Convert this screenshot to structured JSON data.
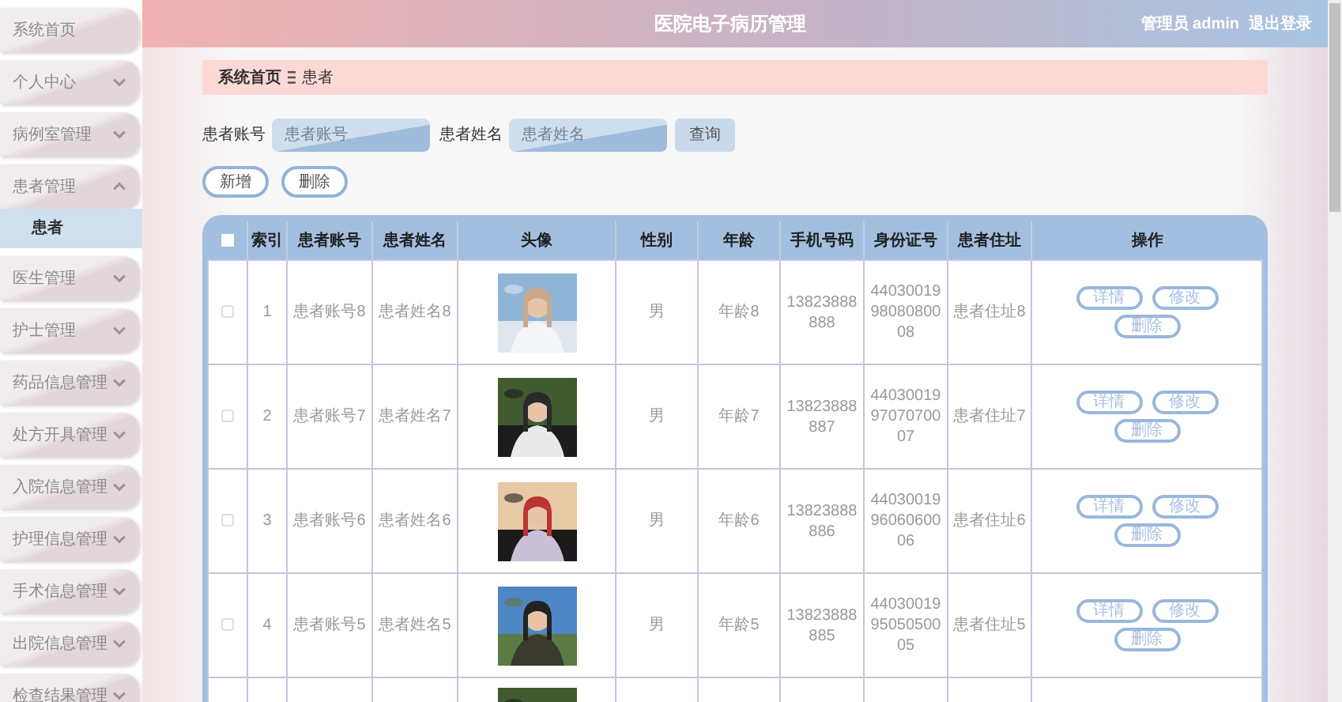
{
  "header": {
    "title": "医院电子病历管理",
    "user": "管理员 admin",
    "logout": "退出登录"
  },
  "sidebar": {
    "items": [
      {
        "label": "系统首页",
        "kind": "link"
      },
      {
        "label": "个人中心",
        "kind": "menu",
        "expanded": false
      },
      {
        "label": "病例室管理",
        "kind": "menu",
        "expanded": false
      },
      {
        "label": "患者管理",
        "kind": "menu",
        "expanded": true,
        "children": [
          {
            "label": "患者",
            "selected": true
          }
        ]
      },
      {
        "label": "医生管理",
        "kind": "menu",
        "expanded": false
      },
      {
        "label": "护士管理",
        "kind": "menu",
        "expanded": false
      },
      {
        "label": "药品信息管理",
        "kind": "menu",
        "expanded": false
      },
      {
        "label": "处方开具管理",
        "kind": "menu",
        "expanded": false
      },
      {
        "label": "入院信息管理",
        "kind": "menu",
        "expanded": false
      },
      {
        "label": "护理信息管理",
        "kind": "menu",
        "expanded": false
      },
      {
        "label": "手术信息管理",
        "kind": "menu",
        "expanded": false
      },
      {
        "label": "出院信息管理",
        "kind": "menu",
        "expanded": false
      },
      {
        "label": "检查结果管理",
        "kind": "menu",
        "expanded": false
      }
    ]
  },
  "breadcrumb": [
    "系统首页",
    "患者"
  ],
  "search": {
    "fields": [
      {
        "label": "患者账号",
        "placeholder": "患者账号"
      },
      {
        "label": "患者姓名",
        "placeholder": "患者姓名"
      }
    ],
    "button": "查询"
  },
  "actions": [
    "新增",
    "删除"
  ],
  "table": {
    "all_checked": false,
    "columns": [
      "索引",
      "患者账号",
      "患者姓名",
      "头像",
      "性别",
      "年龄",
      "手机号码",
      "身份证号",
      "患者住址",
      "操作"
    ],
    "rows": [
      {
        "checked": false,
        "index": "1",
        "account": "患者账号8",
        "name": "患者姓名8",
        "sex": "男",
        "age": "年龄8",
        "phone": "13823888888",
        "id_number": "440300199808080008",
        "address": "患者住址8",
        "buttons": [
          "详情",
          "修改",
          "删除"
        ]
      },
      {
        "checked": false,
        "index": "2",
        "account": "患者账号7",
        "name": "患者姓名7",
        "sex": "男",
        "age": "年龄7",
        "phone": "13823888887",
        "id_number": "440300199707070007",
        "address": "患者住址7",
        "buttons": [
          "详情",
          "修改",
          "删除"
        ]
      },
      {
        "checked": false,
        "index": "3",
        "account": "患者账号6",
        "name": "患者姓名6",
        "sex": "男",
        "age": "年龄6",
        "phone": "13823888886",
        "id_number": "440300199606060006",
        "address": "患者住址6",
        "buttons": [
          "详情",
          "修改",
          "删除"
        ]
      },
      {
        "checked": false,
        "index": "4",
        "account": "患者账号5",
        "name": "患者姓名5",
        "sex": "男",
        "age": "年龄5",
        "phone": "13823888885",
        "id_number": "440300199505050005",
        "address": "患者住址5",
        "buttons": [
          "详情",
          "修改",
          "删除"
        ]
      }
    ]
  }
}
